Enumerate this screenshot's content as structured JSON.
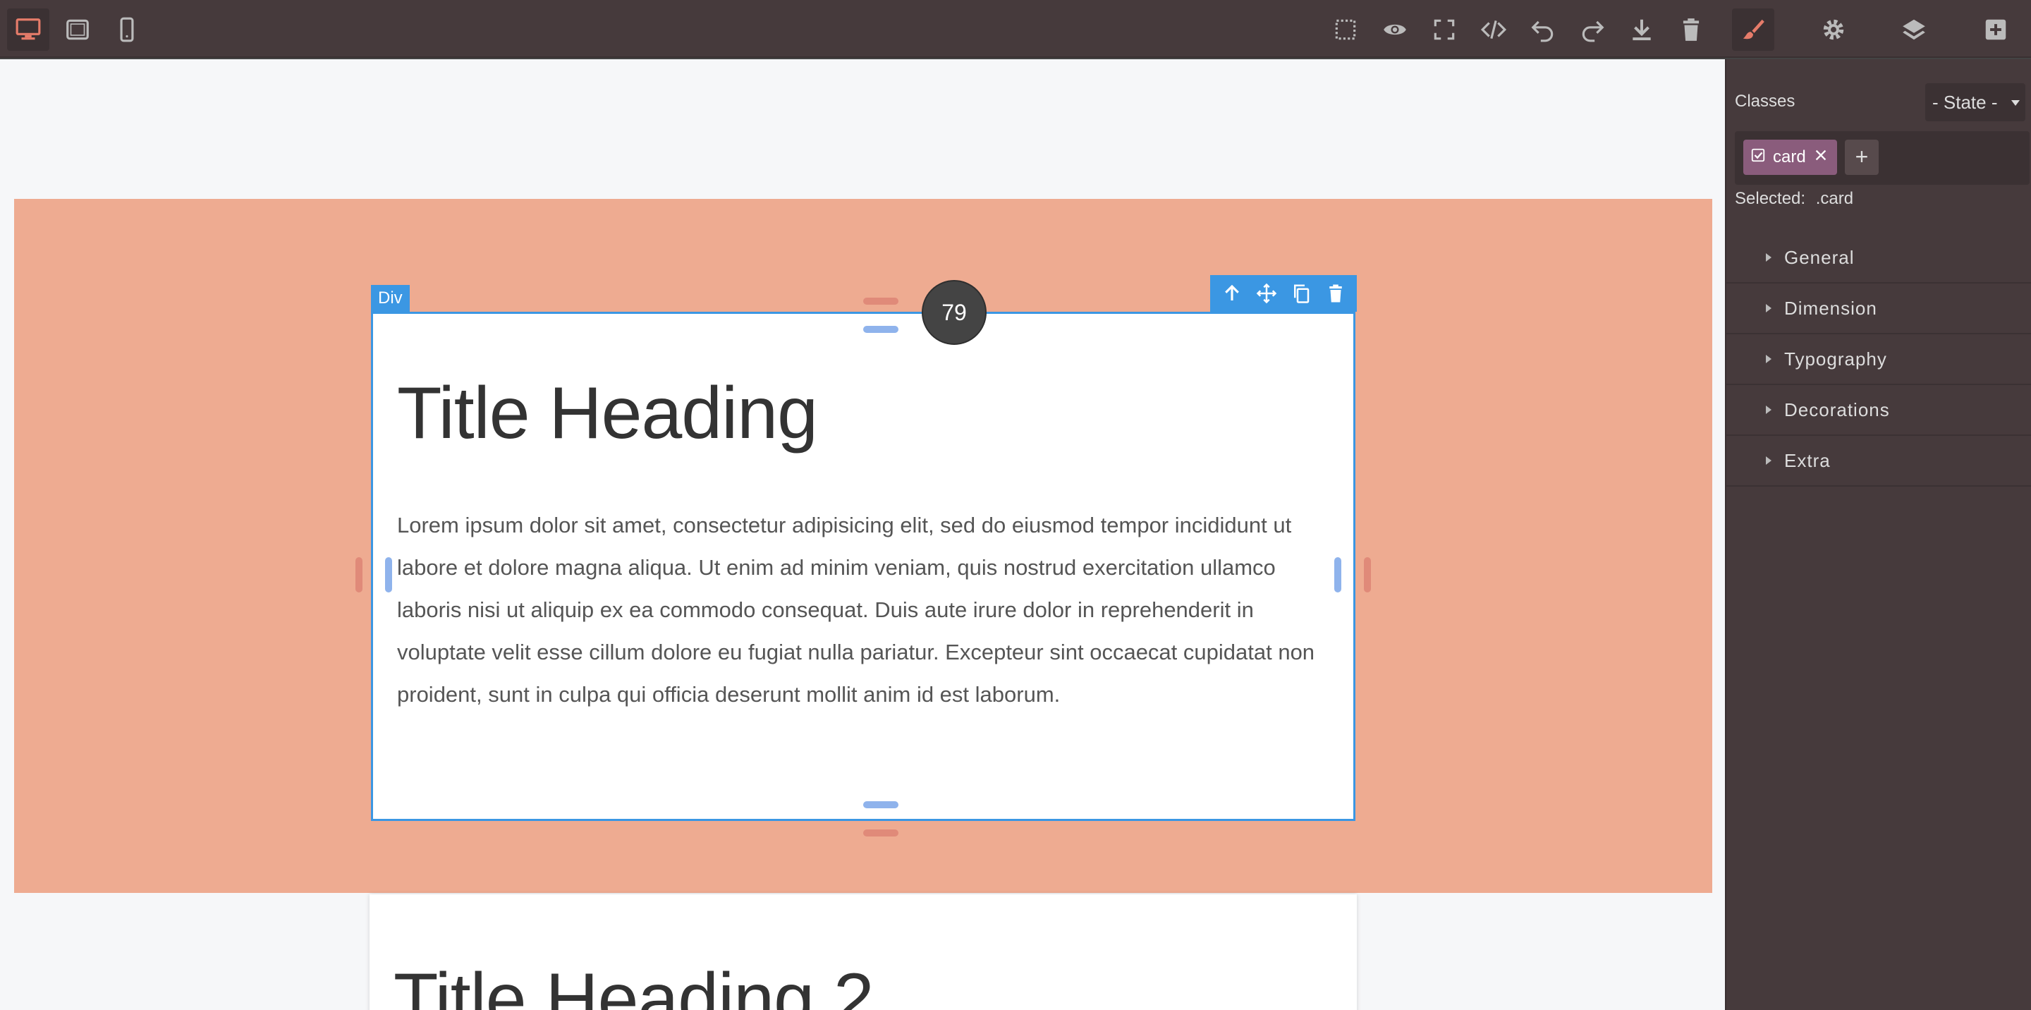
{
  "topbar": {
    "devices": [
      "desktop-icon",
      "tablet-icon",
      "mobile-icon"
    ],
    "actions": [
      "select-outline-icon",
      "eye-icon",
      "fullscreen-icon",
      "code-icon",
      "undo-icon",
      "redo-icon",
      "download-icon",
      "trash-icon"
    ],
    "panels": [
      "paint-brush-icon",
      "gear-icon",
      "layers-icon",
      "add-block-icon"
    ]
  },
  "colors": {
    "accent": "#3b97e3",
    "section_bg": "#eeab91",
    "panel_bg": "#463a3c",
    "tag_bg": "#8a5c7c",
    "active_icon": "#e67c6a"
  },
  "canvas": {
    "badge_name": "Div",
    "counter": "79",
    "card1": {
      "title": "Title Heading",
      "text": "Lorem ipsum dolor sit amet, consectetur adipisicing elit, sed do eiusmod tempor incididunt ut labore et dolore magna aliqua. Ut enim ad minim veniam, quis nostrud exercitation ullamco laboris nisi ut aliquip ex ea commodo consequat. Duis aute irure dolor in reprehenderit in voluptate velit esse cillum dolore eu fugiat nulla pariatur. Excepteur sint occaecat cupidatat non proident, sunt in culpa qui officia deserunt mollit anim id est laborum."
    },
    "card2": {
      "title": "Title Heading 2"
    }
  },
  "panel": {
    "classes_label": "Classes",
    "state_label": "- State -",
    "tag": "card",
    "add_label": "+",
    "selected_label": "Selected:",
    "selected_value": ".card",
    "sectors": [
      "General",
      "Dimension",
      "Typography",
      "Decorations",
      "Extra"
    ]
  }
}
